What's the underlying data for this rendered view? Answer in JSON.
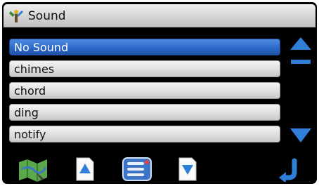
{
  "window": {
    "title": "Sound",
    "title_icon": "tools-icon"
  },
  "sound_list": {
    "items": [
      {
        "label": "No Sound",
        "selected": true
      },
      {
        "label": "chimes",
        "selected": false
      },
      {
        "label": "chord",
        "selected": false
      },
      {
        "label": "ding",
        "selected": false
      },
      {
        "label": "notify",
        "selected": false
      }
    ]
  },
  "scroll": {
    "up_icon": "scroll-up-icon",
    "down_icon": "scroll-down-icon"
  },
  "toolbar": {
    "buttons": [
      {
        "icon": "map-icon"
      },
      {
        "icon": "page-up-icon"
      },
      {
        "icon": "menu-list-icon"
      },
      {
        "icon": "page-down-icon"
      },
      {
        "icon": "back-arrow-icon"
      }
    ]
  },
  "colors": {
    "selection": "#2b67c6",
    "accent_blue": "#2f6fd0",
    "background": "#000000"
  }
}
